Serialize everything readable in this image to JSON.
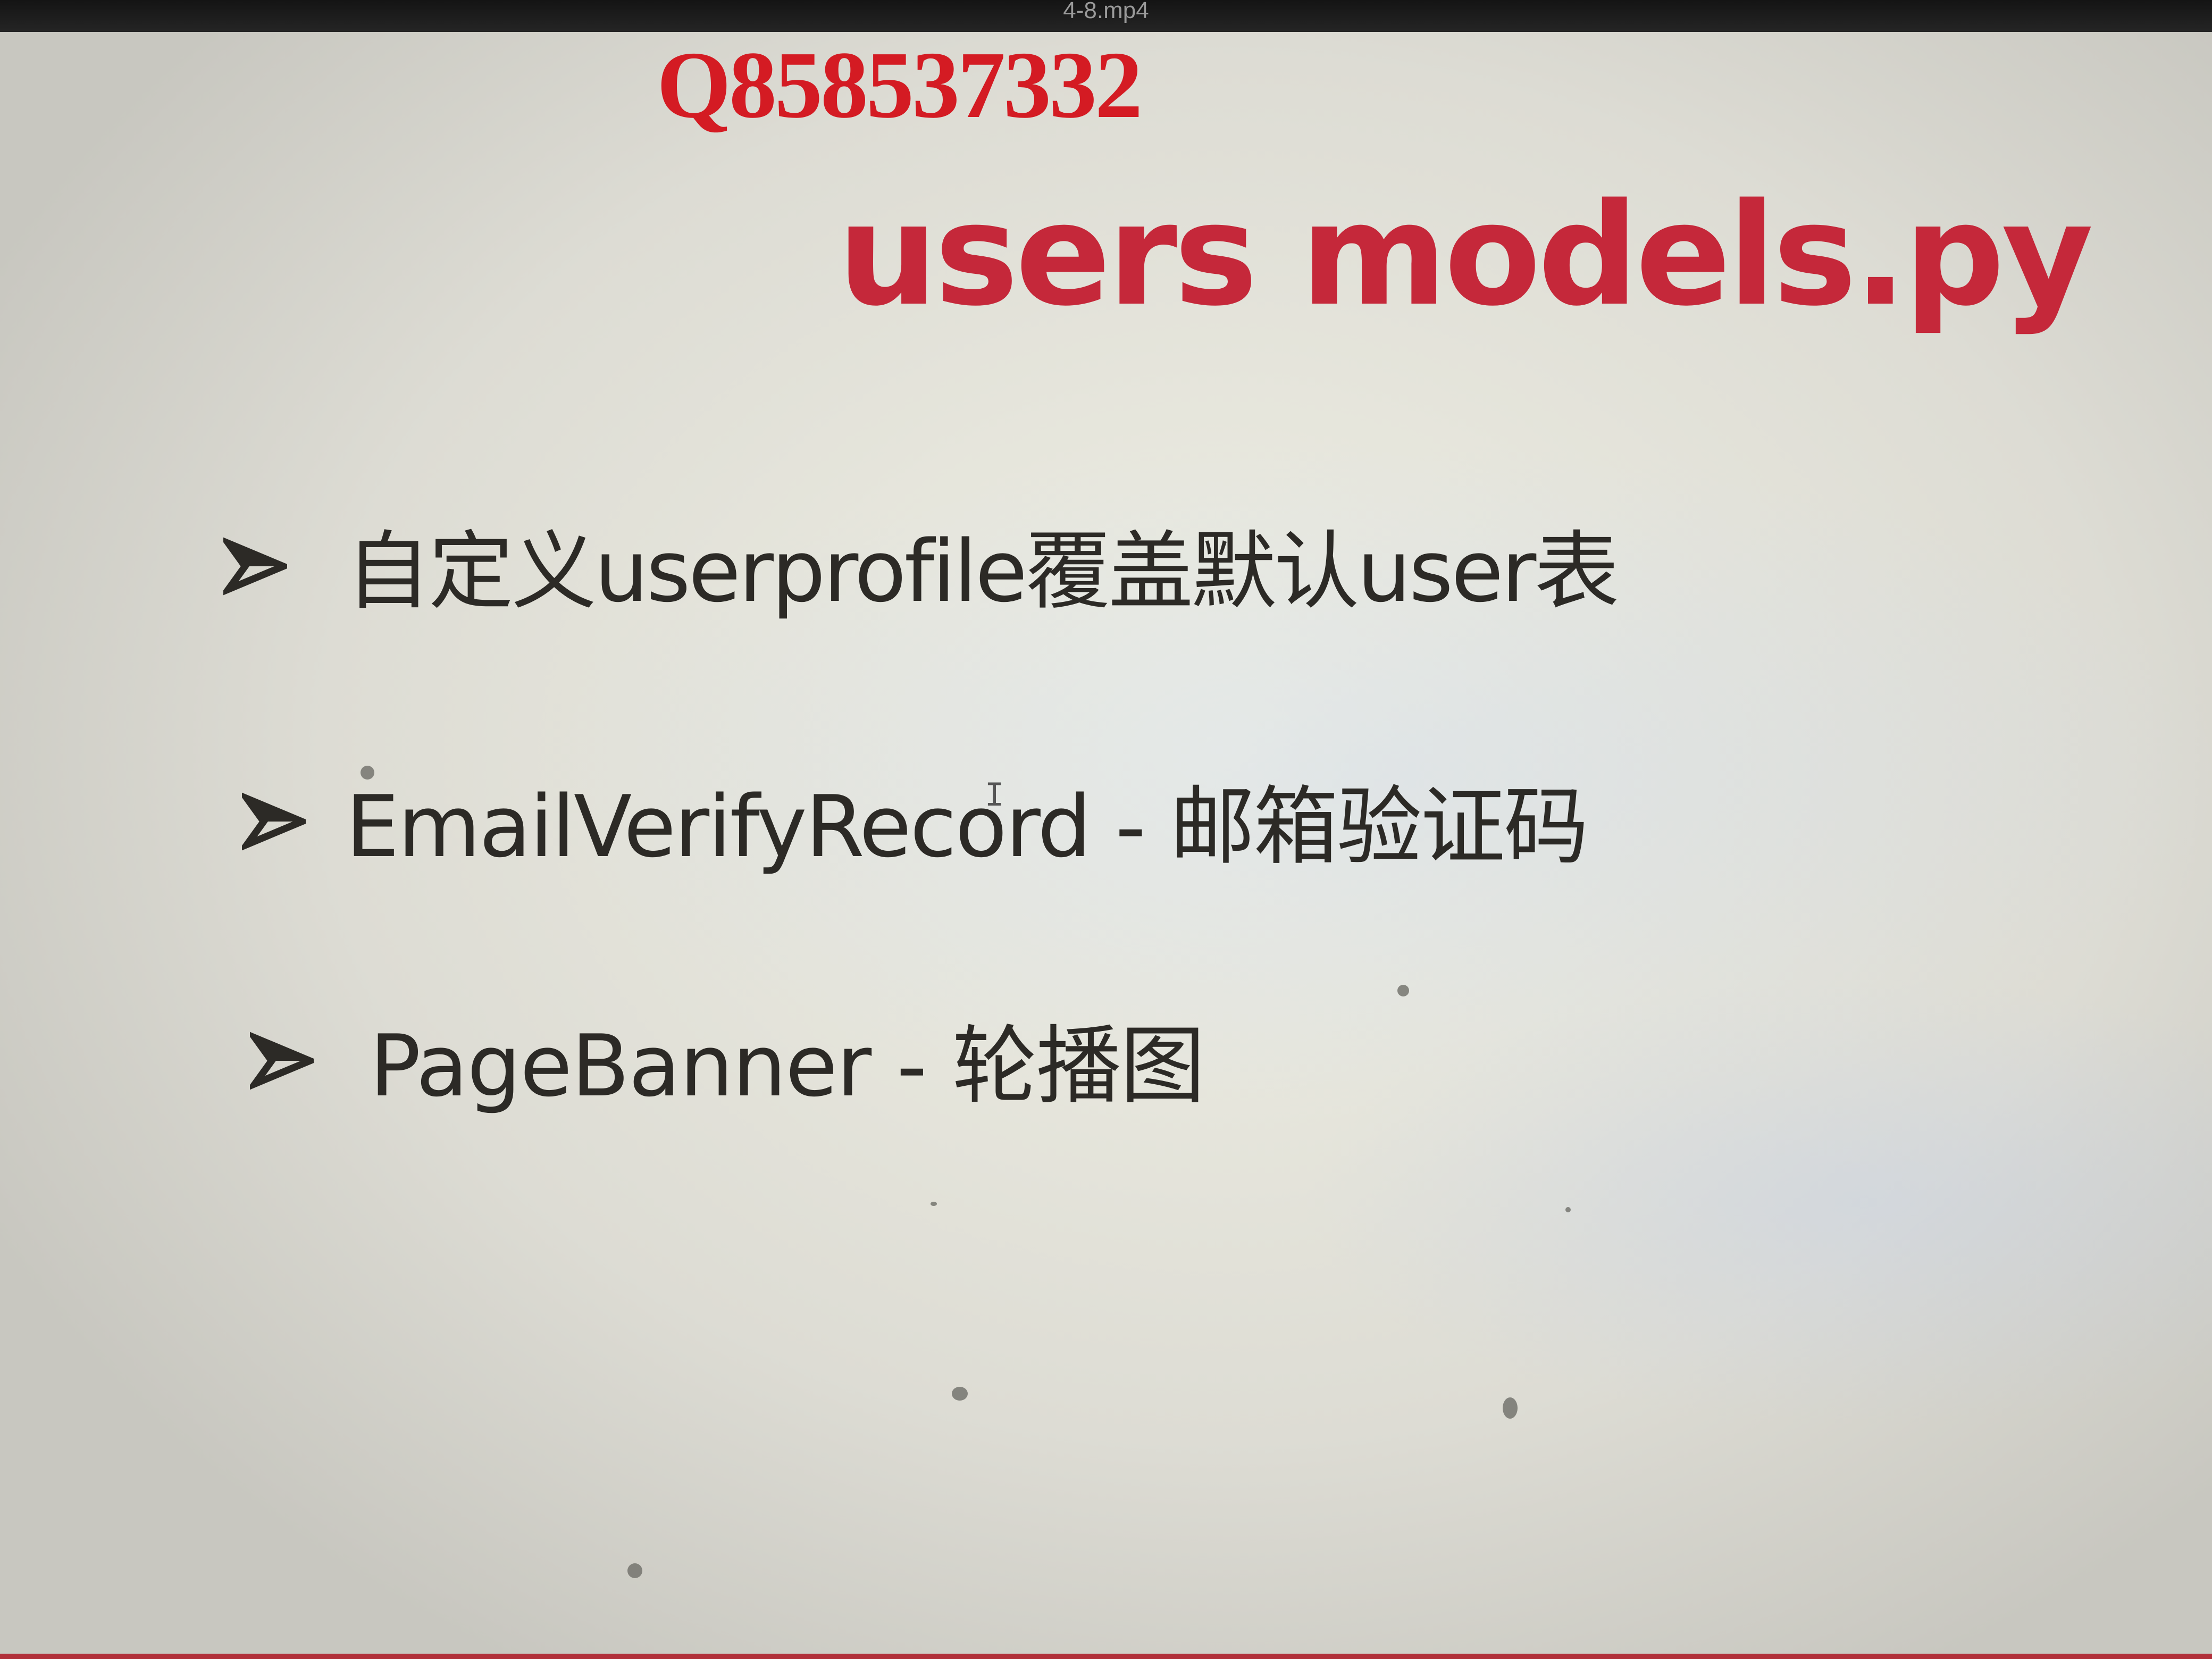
{
  "window": {
    "title": "4-8.mp4"
  },
  "slide": {
    "watermark": "Q858537332",
    "title": "users models.py",
    "bullets": [
      {
        "icon": "arrowhead-bullet-icon",
        "text": "自定义userprofile覆盖默认user表"
      },
      {
        "icon": "arrowhead-bullet-icon",
        "text": "EmailVerifyRecord - 邮箱验证码"
      },
      {
        "icon": "arrowhead-bullet-icon",
        "text": "PageBanner - 轮播图"
      }
    ]
  },
  "colors": {
    "watermark": "#d41b23",
    "title": "#c5283a",
    "body_text": "#2c2a26",
    "slide_background": "#ecebe3"
  }
}
